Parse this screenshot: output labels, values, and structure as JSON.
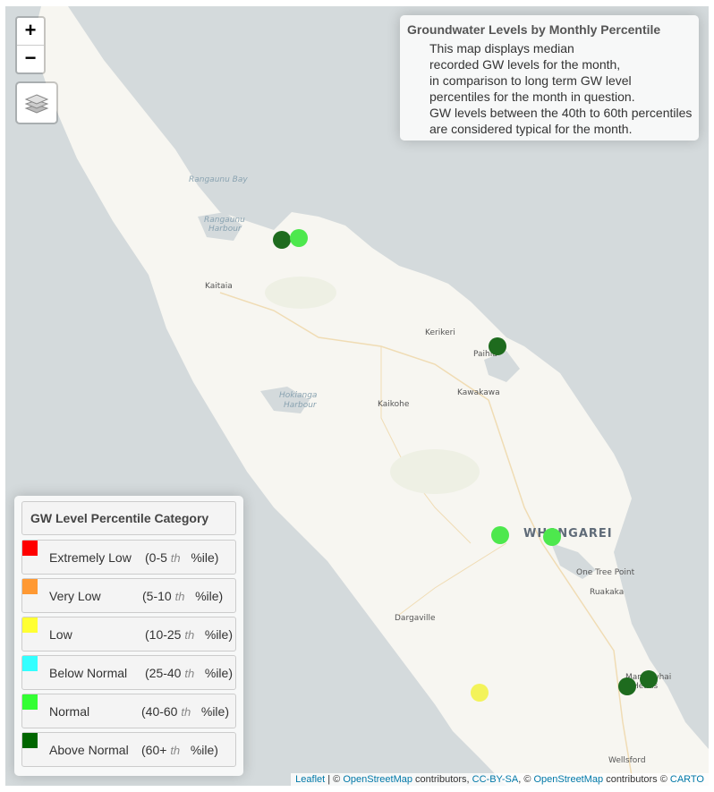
{
  "zoom": {
    "in_label": "+",
    "out_label": "−"
  },
  "layers_icon": "layers-icon",
  "info": {
    "title": "Groundwater Levels by Monthly Percentile",
    "lines": [
      "This map displays median",
      "recorded GW levels for the month,",
      "in comparison to long term GW level",
      "percentiles for the month in question.",
      "GW levels between the 40th to 60th percentiles",
      "are considered typical for the month."
    ]
  },
  "legend": {
    "title": "GW Level Percentile Category",
    "items": [
      {
        "label": "Extremely Low",
        "range_open": "(0-5",
        "th": "th",
        "range_close": "%ile)",
        "color": "#ff0000"
      },
      {
        "label": "Very Low",
        "range_open": "(5-10",
        "th": "th",
        "range_close": "%ile)",
        "color": "#ff9933"
      },
      {
        "label": "Low",
        "range_open": "(10-25",
        "th": "th",
        "range_close": "%ile)",
        "color": "#ffff33"
      },
      {
        "label": "Below Normal",
        "range_open": "(25-40",
        "th": "th",
        "range_close": "%ile)",
        "color": "#33ffff"
      },
      {
        "label": "Normal",
        "range_open": "(40-60",
        "th": "th",
        "range_close": "%ile)",
        "color": "#33ff33"
      },
      {
        "label": "Above Normal",
        "range_open": "(60+",
        "th": "th",
        "range_close": "%ile)",
        "color": "#006600"
      }
    ]
  },
  "places": {
    "rangaunu_bay": "Rangaunu Bay",
    "rangaunu_harbour_1": "Rangaunu",
    "rangaunu_harbour_2": "Harbour",
    "kaitaia": "Kaitaia",
    "kerikeri": "Kerikeri",
    "paihia": "Paihia",
    "kawakawa": "Kawakawa",
    "hokianga_1": "Hokianga",
    "hokianga_2": "Harbour",
    "kaikohe": "Kaikohe",
    "whangarei": "WHANGAREI",
    "one_tree_point": "One Tree Point",
    "ruakaka": "Ruakaka",
    "dargaville": "Dargaville",
    "mangawhai_1": "Mangawhai",
    "mangawhai_2": "Heads",
    "wellsford": "Wellsford"
  },
  "sites": [
    {
      "category": "Above Normal",
      "color": "#1e6b1e"
    },
    {
      "category": "Normal",
      "color": "#4de84d"
    },
    {
      "category": "Above Normal",
      "color": "#1e6b1e"
    },
    {
      "category": "Normal",
      "color": "#4de84d"
    },
    {
      "category": "Normal",
      "color": "#4de84d"
    },
    {
      "category": "Low",
      "color": "#f3f35a"
    },
    {
      "category": "Above Normal",
      "color": "#1e6b1e"
    },
    {
      "category": "Above Normal",
      "color": "#1e6b1e"
    }
  ],
  "attribution": {
    "leaflet": "Leaflet",
    "sep1": " | © ",
    "osm": "OpenStreetMap",
    "contrib1": " contributors, ",
    "ccbysa": "CC-BY-SA",
    "sep2": ", © ",
    "osm2": "OpenStreetMap",
    "contrib2": " contributors © ",
    "carto": "CARTO"
  }
}
